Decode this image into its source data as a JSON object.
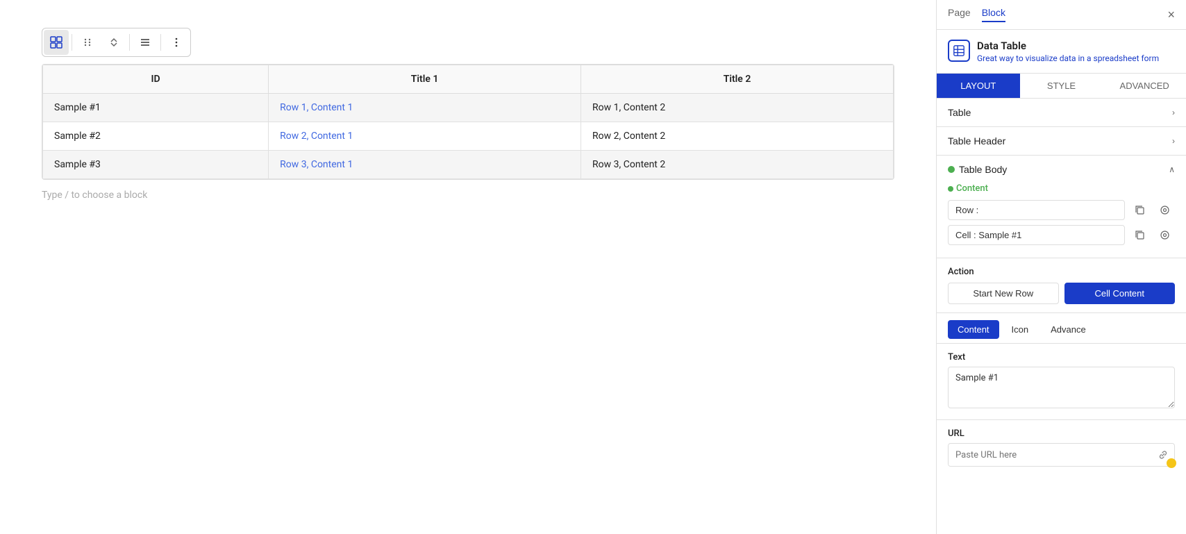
{
  "editor": {
    "toolbar": {
      "grid_icon": "⊞",
      "drag_icon": "⠿",
      "arrow_icon": "⌃",
      "align_icon": "☰",
      "more_icon": "⋮"
    },
    "table": {
      "headers": [
        "ID",
        "Title 1",
        "Title 2"
      ],
      "rows": [
        [
          "Sample #1",
          "Row 1, Content 1",
          "Row 1, Content 2"
        ],
        [
          "Sample #2",
          "Row 2, Content 1",
          "Row 2, Content 2"
        ],
        [
          "Sample #3",
          "Row 3, Content 1",
          "Row 3, Content 2"
        ]
      ]
    },
    "placeholder": "Type / to choose a block"
  },
  "panel": {
    "tabs": [
      "Page",
      "Block"
    ],
    "active_tab": "Block",
    "close_label": "×",
    "data_table": {
      "title": "Data Table",
      "description": "Great way to visualize data in a spreadsheet form"
    },
    "layout_tabs": [
      "LAYOUT",
      "STYLE",
      "ADVANCED"
    ],
    "active_layout_tab": "LAYOUT",
    "sections": {
      "table": {
        "label": "Table",
        "expanded": false
      },
      "table_header": {
        "label": "Table Header",
        "expanded": false
      },
      "table_body": {
        "label": "Table Body",
        "expanded": true
      }
    },
    "content": {
      "label": "Content",
      "row_label": "Row :",
      "cell_label": "Cell : Sample #1"
    },
    "action": {
      "label": "Action",
      "buttons": [
        "Start New Row",
        "Cell Content"
      ],
      "active_button": "Cell Content"
    },
    "content_tabs": [
      "Content",
      "Icon",
      "Advance"
    ],
    "active_content_tab": "Content",
    "text": {
      "label": "Text",
      "value": "Sample #1"
    },
    "url": {
      "label": "URL",
      "placeholder": "Paste URL here"
    }
  }
}
